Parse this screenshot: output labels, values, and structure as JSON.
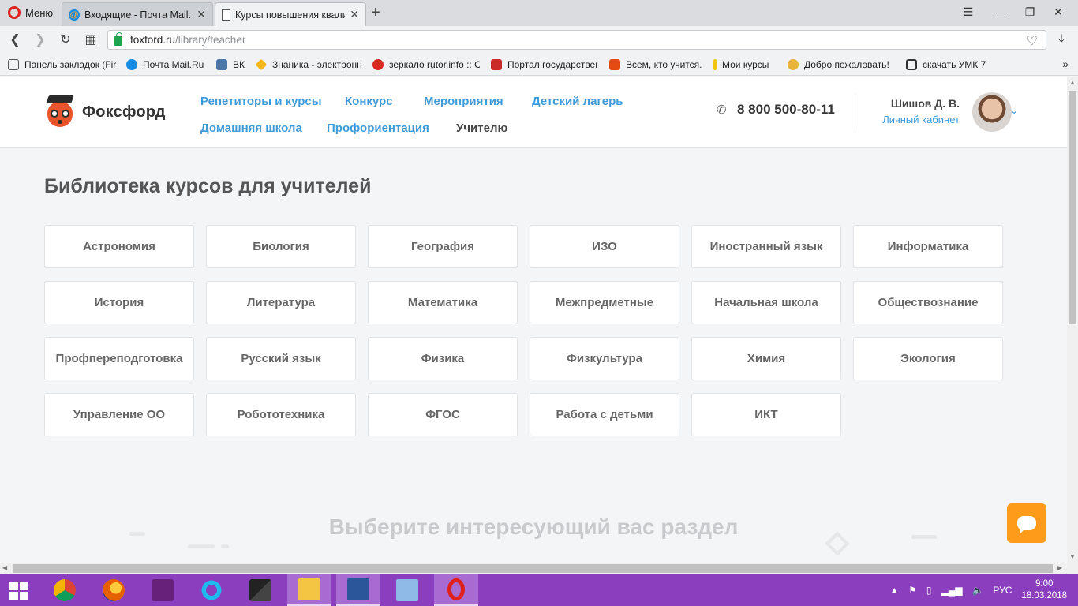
{
  "browser": {
    "menu_label": "Меню",
    "tabs": [
      {
        "title": "Входящие - Почта Mail.Ru",
        "active": false
      },
      {
        "title": "Курсы повышения квалиф",
        "active": true
      }
    ],
    "new_tab": "+",
    "url_host": "foxford.ru",
    "url_path": "/library/teacher"
  },
  "bookmarks": [
    {
      "label": "Панель закладок (Fir",
      "color": "#ffffff"
    },
    {
      "label": "Почта Mail.Ru",
      "color": "#168de2"
    },
    {
      "label": "ВК",
      "color": "#4a76a8"
    },
    {
      "label": "Знаника - электронн",
      "color": "#f2b71c"
    },
    {
      "label": "зеркало rutor.info :: С",
      "color": "#d62a1e"
    },
    {
      "label": "Портал государствен",
      "color": "#cc2b2b"
    },
    {
      "label": "Всем, кто учится.",
      "color": "#e44b12"
    },
    {
      "label": "Мои курсы",
      "color": "#f2c40f"
    },
    {
      "label": "Добро пожаловать!",
      "color": "#e8b43a"
    },
    {
      "label": "скачать УМК 7",
      "color": "#333333"
    }
  ],
  "site": {
    "logo_text": "Фоксфорд",
    "nav": [
      {
        "label": "Репетиторы и курсы"
      },
      {
        "label": "Конкурс"
      },
      {
        "label": "Мероприятия"
      },
      {
        "label": "Детский лагерь"
      },
      {
        "label": "Домашняя школа"
      },
      {
        "label": "Профориентация"
      },
      {
        "label": "Учителю"
      }
    ],
    "phone": "8 800 500-80-11",
    "user_name": "Шишов Д. В.",
    "user_cabinet": "Личный кабинет",
    "accent_color": "#3f9ad8",
    "chat_color": "#ff9b1a"
  },
  "main": {
    "title": "Библиотека курсов для учителей",
    "subjects": [
      "Астрономия",
      "Биология",
      "География",
      "ИЗО",
      "Иностранный язык",
      "Информатика",
      "История",
      "Литература",
      "Математика",
      "Межпредметные",
      "Начальная школа",
      "Обществознание",
      "Профпереподготовка",
      "Русский язык",
      "Физика",
      "Физкультура",
      "Химия",
      "Экология",
      "Управление ОО",
      "Робототехника",
      "ФГОС",
      "Работа с детьми",
      "ИКТ"
    ],
    "section_title": "Выберите интересующий вас раздел"
  },
  "taskbar": {
    "apps": [
      "chrome",
      "firefox",
      "visual-studio",
      "internet-explorer",
      "game-app",
      "file-explorer",
      "word",
      "calculator",
      "opera"
    ],
    "language": "РУС",
    "time": "9:00",
    "date": "18.03.2018"
  }
}
